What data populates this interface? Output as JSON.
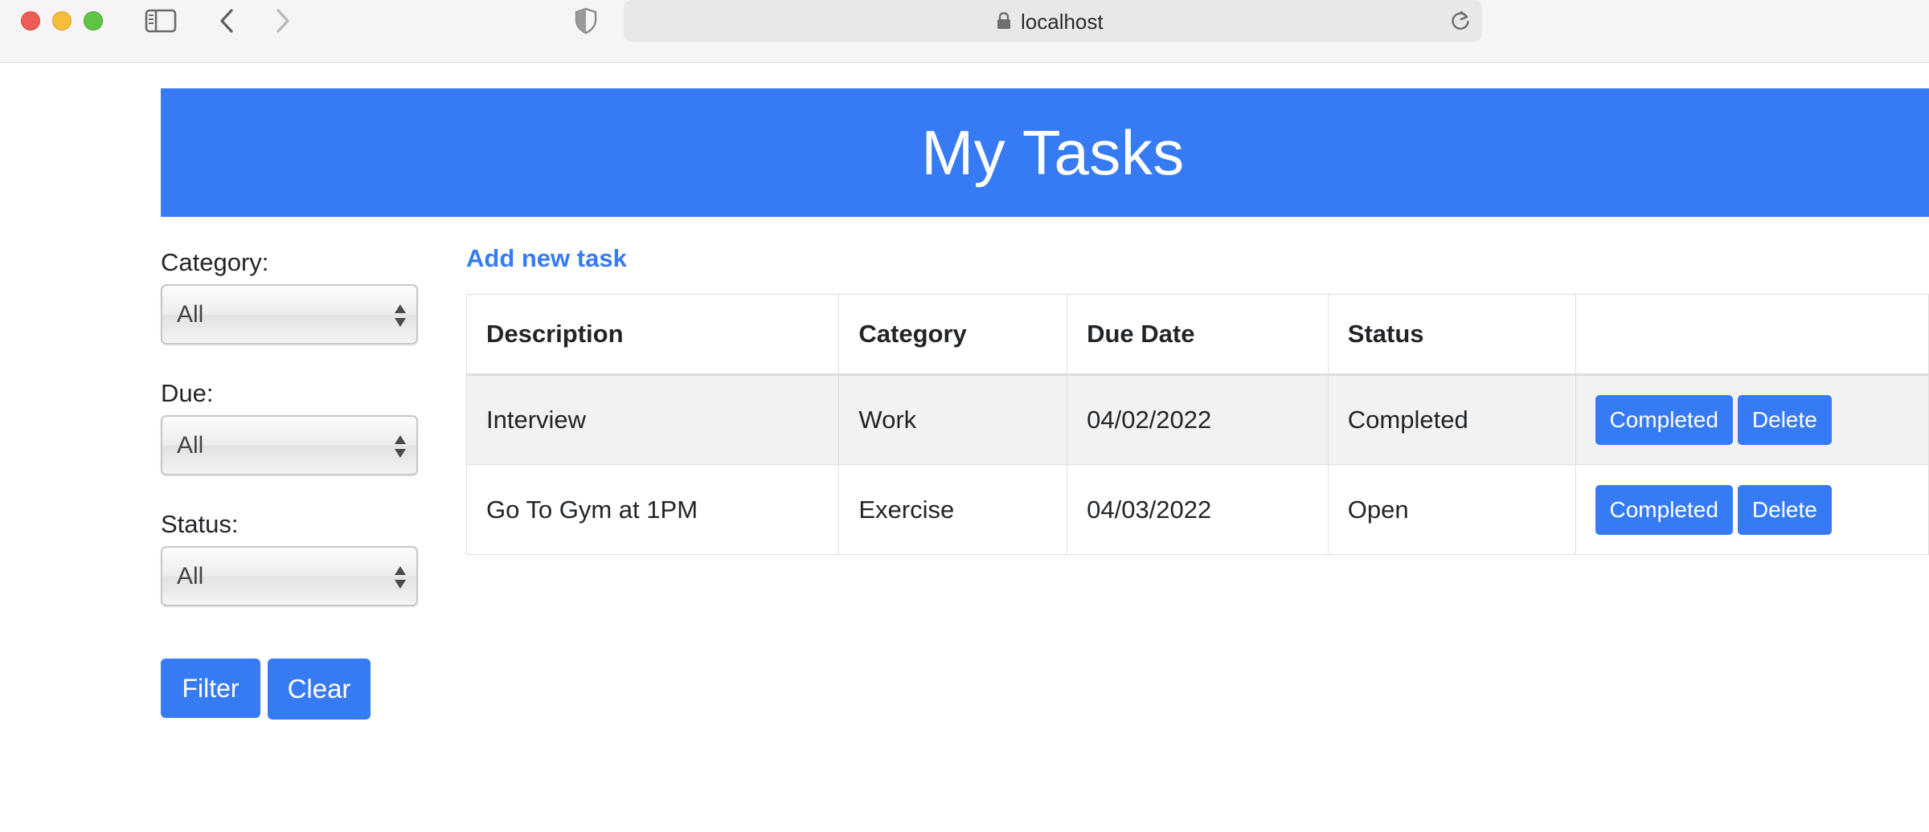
{
  "browser": {
    "url": "localhost"
  },
  "page": {
    "title": "My Tasks"
  },
  "filters": {
    "category": {
      "label": "Category:",
      "value": "All"
    },
    "due": {
      "label": "Due:",
      "value": "All"
    },
    "status": {
      "label": "Status:",
      "value": "All"
    },
    "filter_label": "Filter",
    "clear_label": "Clear"
  },
  "tasks": {
    "add_label": "Add new task",
    "columns": {
      "description": "Description",
      "category": "Category",
      "due_date": "Due Date",
      "status": "Status"
    },
    "rows": [
      {
        "description": "Interview",
        "category": "Work",
        "due_date": "04/02/2022",
        "status": "Completed",
        "complete_label": "Completed",
        "delete_label": "Delete"
      },
      {
        "description": "Go To Gym at 1PM",
        "category": "Exercise",
        "due_date": "04/03/2022",
        "status": "Open",
        "complete_label": "Completed",
        "delete_label": "Delete"
      }
    ]
  },
  "colors": {
    "accent": "#377bf4",
    "row_stripe": "#f2f2f2"
  },
  "icons": {
    "chrome": [
      "sidebar-toggle-icon",
      "back-icon",
      "forward-icon",
      "shield-icon",
      "lock-icon",
      "reload-icon"
    ],
    "select": "updown-arrows-icon"
  }
}
